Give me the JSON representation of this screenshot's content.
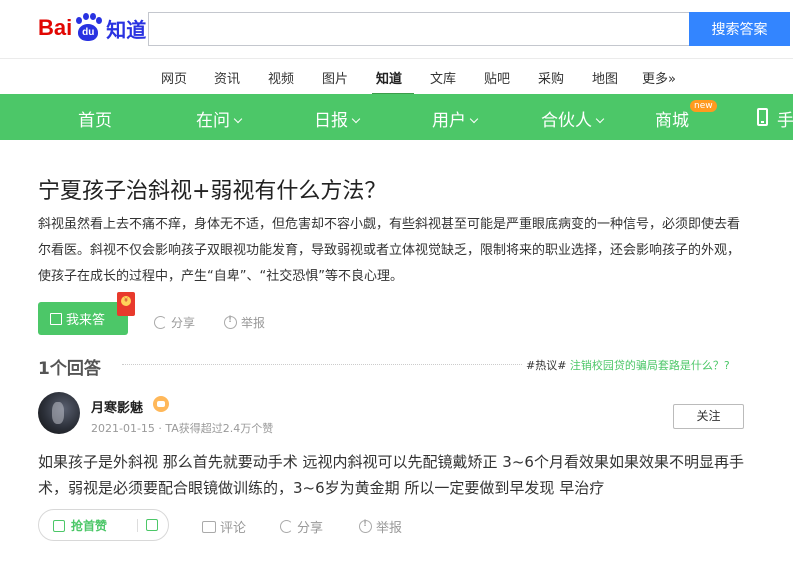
{
  "header": {
    "logo_bai": "Bai",
    "logo_du": "du",
    "logo_zhidao": "知道",
    "search_placeholder": "",
    "search_button": "搜索答案"
  },
  "subnav": [
    "网页",
    "资讯",
    "视频",
    "图片",
    "知道",
    "文库",
    "贴吧",
    "采购",
    "地图",
    "更多»"
  ],
  "subnav_active": "知道",
  "greenbar": {
    "items": [
      "首页",
      "在问",
      "日报",
      "用户",
      "合伙人",
      "商城",
      "手"
    ],
    "new_badge": "new"
  },
  "question": {
    "title": "宁夏孩子治斜视+弱视有什么方法？",
    "desc": "斜视虽然看上去不痛不痒，身体无不适，但危害却不容小觑，有些斜视甚至可能是严重眼底病变的一种信号，必须即使去看 尔看医。斜视不仅会影响孩子双眼视功能发育，导致弱视或者立体视觉缺乏，限制将来的职业选择，还会影响孩子的外观，使孩子在成长的过程中，产生“自卑”、“社交恐惧”等不良心理。",
    "answer_button": "我来答",
    "share": "分享",
    "report": "举报"
  },
  "answers_header": {
    "count": "1个回答",
    "hot_tag": "#热议#",
    "hot_text": " 注销校园贷的骗局套路是什么？?"
  },
  "answer": {
    "username": "月寒影魅",
    "meta": "2021-01-15 · TA获得超过2.4万个赞",
    "follow": "关注",
    "text": "如果孩子是外斜视 那么首先就要动手术 远视内斜视可以先配镜戴矫正 3~6个月看效果如果效果不明显再手术，弱视是必须要配合眼镜做训练的，3~6岁为黄金期 所以一定要做到早发现 早治疗",
    "like": "抢首赞",
    "comment": "评论",
    "share": "分享",
    "report": "举报"
  },
  "colors": {
    "green": "#4cc768",
    "search_blue": "#3385ff",
    "logo_red": "#e10602",
    "logo_blue": "#2932e1"
  }
}
